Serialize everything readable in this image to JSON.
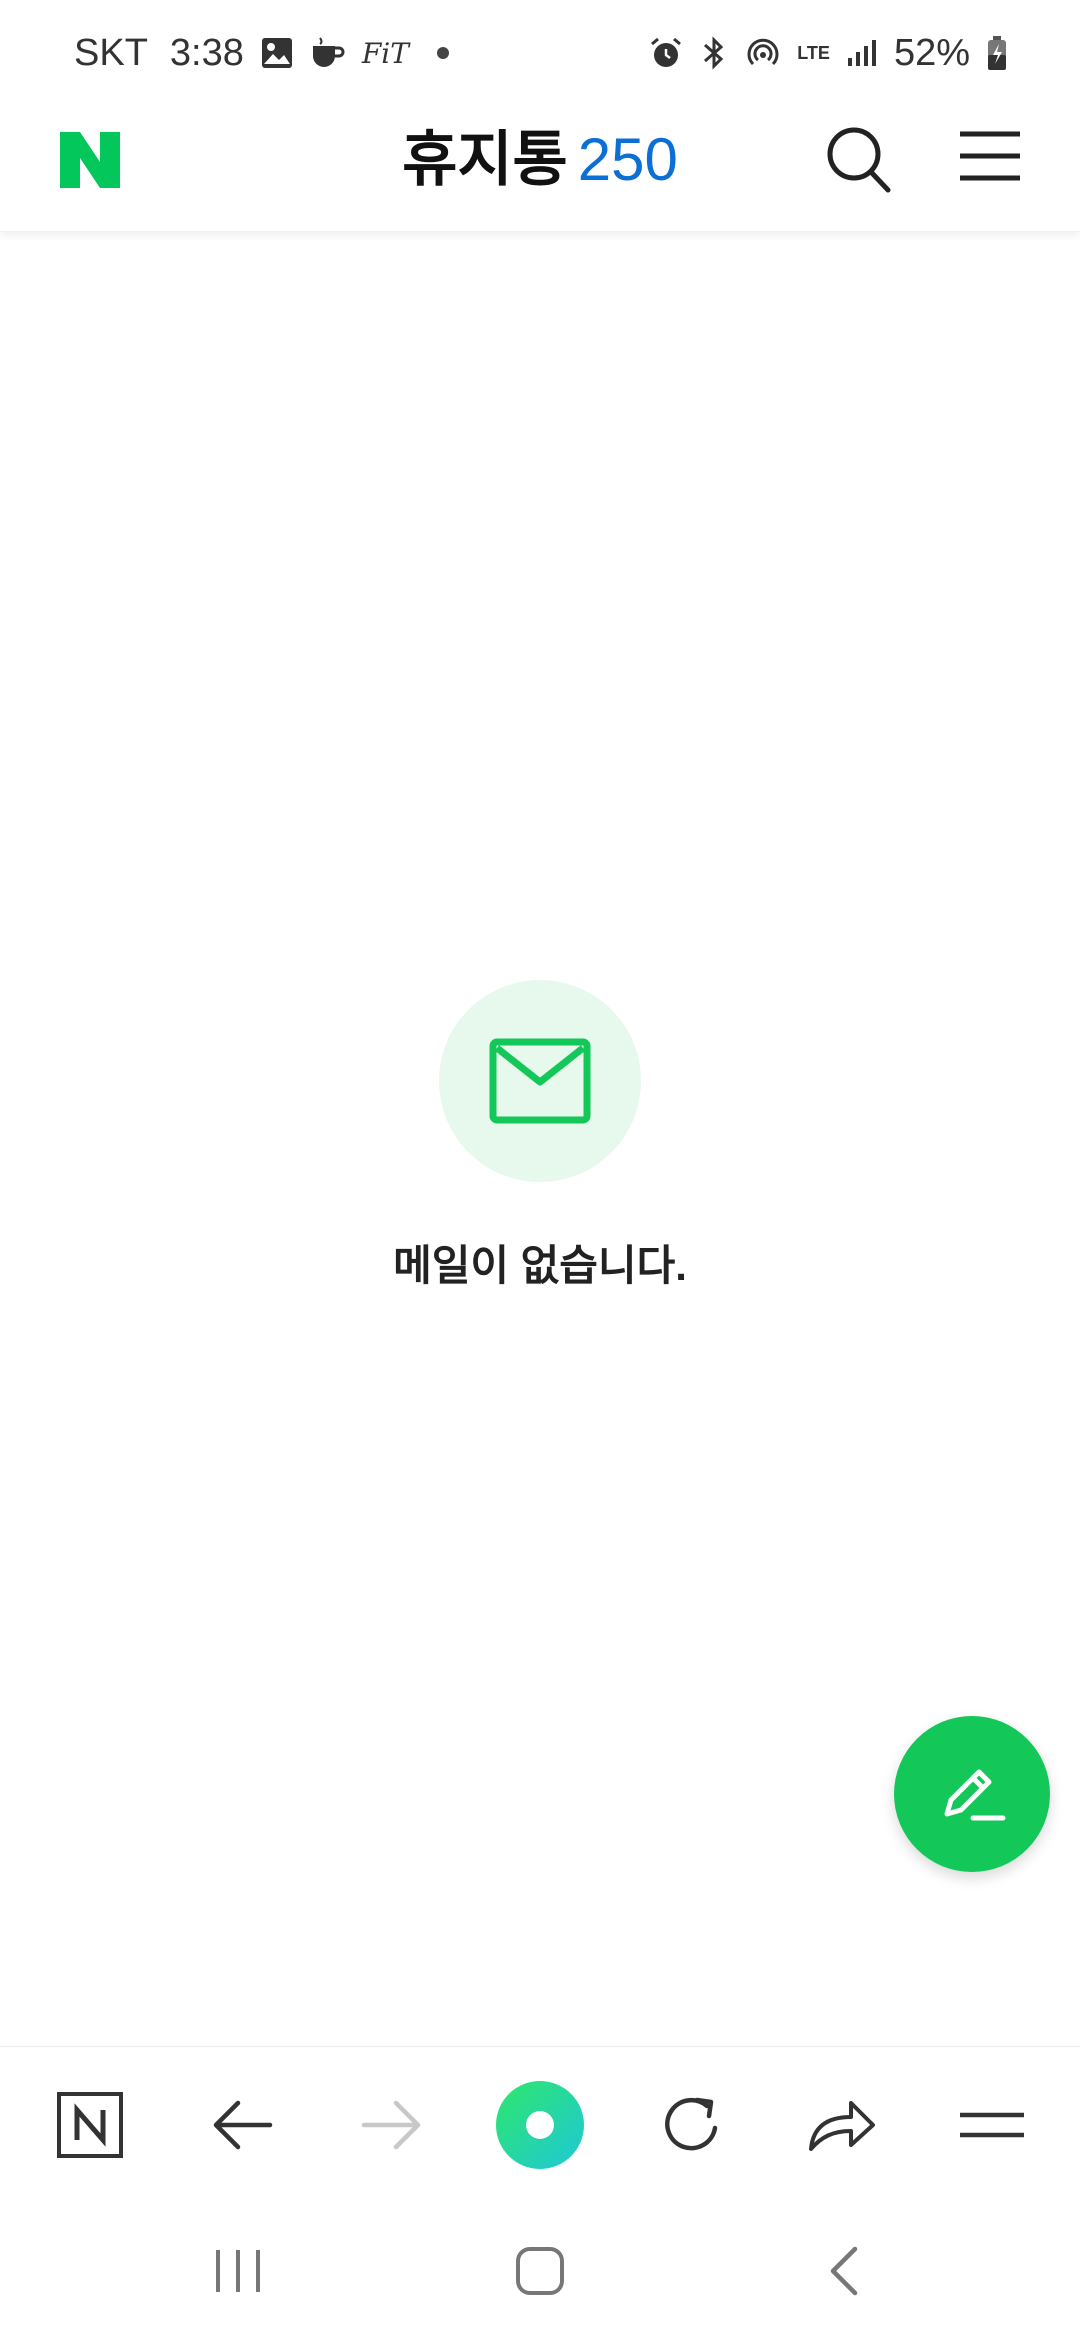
{
  "status_bar": {
    "carrier": "SKT",
    "time": "3:38",
    "fit_label": "FiT",
    "network": "LTE",
    "battery": "52%"
  },
  "header": {
    "title": "휴지통",
    "count": "250",
    "brand_color": "#03c75a",
    "count_color": "#0b6fd6"
  },
  "empty_state": {
    "message": "메일이 없습니다."
  },
  "fab": {
    "icon": "pencil-icon",
    "color": "#14c759"
  },
  "toolbar": {
    "icons": [
      "naver-home-icon",
      "back-arrow-icon",
      "forward-arrow-icon",
      "green-dot-icon",
      "refresh-icon",
      "share-icon",
      "menu-icon"
    ]
  },
  "system_nav": {
    "icons": [
      "recents-icon",
      "home-icon",
      "back-icon"
    ]
  }
}
